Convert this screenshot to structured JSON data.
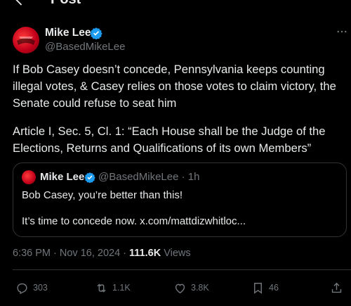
{
  "header": {
    "title": "Post"
  },
  "author": {
    "name": "Mike Lee",
    "handle": "@BasedMikeLee"
  },
  "post": {
    "paragraph1": "If Bob Casey doesn’t concede, Pennsylvania keeps counting illegal votes, & Casey relies on those votes to claim victory, the Senate could refuse to seat him",
    "paragraph2": "Article I, Sec. 5, Cl. 1: “Each House shall be the Judge of the Elections, Returns and Qualifications of its own Members”"
  },
  "quote": {
    "name": "Mike Lee",
    "handle_time": "@BasedMikeLee · 1h",
    "line1": "Bob Casey, you’re better than this!",
    "line2": "It’s time to concede now. x.com/mattdizwhitloc..."
  },
  "meta": {
    "timestamp": "6:36 PM · Nov 16, 2024 · ",
    "views_count": "111.6K",
    "views_label": " Views"
  },
  "actions": {
    "replies": "303",
    "reposts": "1.1K",
    "likes": "3.8K",
    "bookmarks": "46"
  },
  "colors": {
    "verified": "#1d9bf0",
    "muted": "#71767b",
    "text": "#e7e9ea",
    "border": "#2f3336"
  },
  "icons": [
    "back-arrow-icon",
    "verified-icon",
    "more-icon",
    "reply-icon",
    "repost-icon",
    "like-icon",
    "bookmark-icon",
    "share-icon"
  ]
}
